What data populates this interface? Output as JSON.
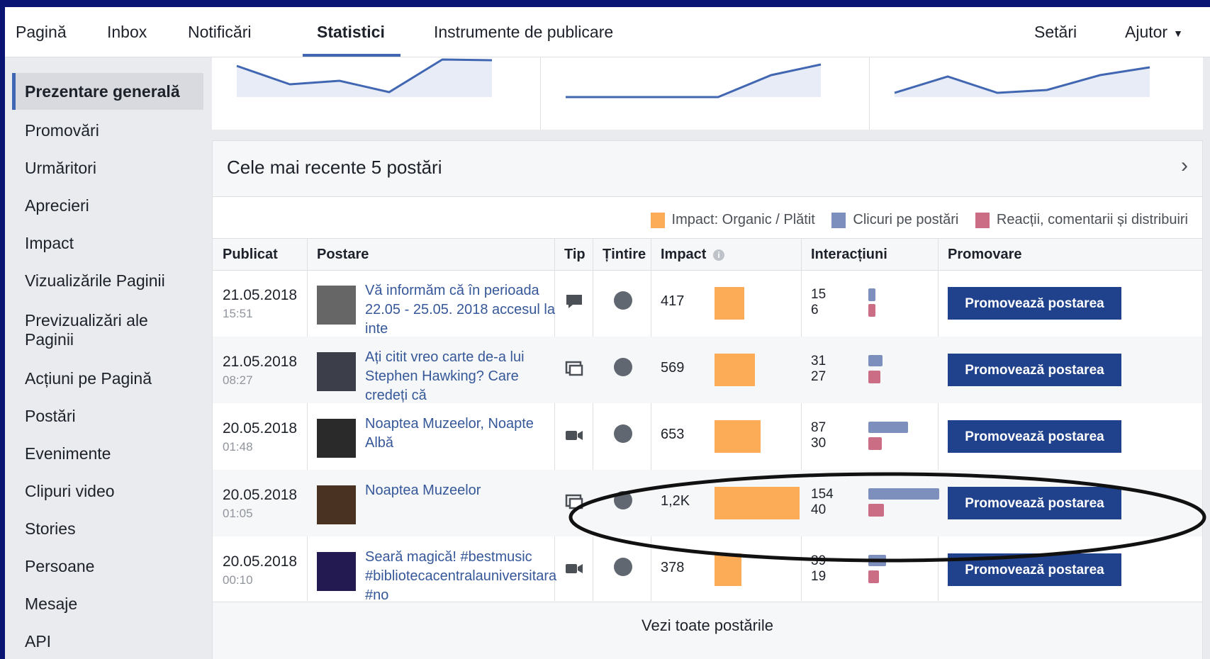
{
  "nav": {
    "tabs": [
      "Pagină",
      "Inbox",
      "Notificări",
      "Statistici",
      "Instrumente de publicare"
    ],
    "right": [
      "Setări",
      "Ajutor"
    ],
    "active_tab": "Statistici"
  },
  "sidebar": {
    "items": [
      "Prezentare generală",
      "Promovări",
      "Urmăritori",
      "Aprecieri",
      "Impact",
      "Vizualizările Paginii",
      "Previzualizări ale Paginii",
      "Acțiuni pe Pagină",
      "Postări",
      "Evenimente",
      "Clipuri video",
      "Stories",
      "Persoane",
      "Mesaje",
      "API"
    ],
    "active": "Prezentare generală"
  },
  "panel": {
    "title": "Cele mai recente 5 postări",
    "legend": [
      {
        "label": "Impact: Organic / Plătit",
        "color": "#fcab57"
      },
      {
        "label": "Clicuri pe postări",
        "color": "#7d8fbd"
      },
      {
        "label": "Reacții, comentarii și distribuiri",
        "color": "#cc6d86"
      }
    ],
    "columns": [
      "Publicat",
      "Postare",
      "Tip",
      "Țintire",
      "Impact",
      "Interacțiuni",
      "Promovare"
    ],
    "see_all": "Vezi toate postările",
    "promote_label": "Promovează postarea"
  },
  "posts": [
    {
      "date": "21.05.2018",
      "time": "15:51",
      "text": "Vă informăm că în perioada 22.05 - 25.05. 2018 accesul la inte",
      "type": "status",
      "impact": "417",
      "impact_value": 417,
      "clicks": "15",
      "reactions": "6"
    },
    {
      "date": "21.05.2018",
      "time": "08:27",
      "text": "Ați citit vreo carte de-a lui Stephen Hawking? Care credeți că",
      "type": "album",
      "impact": "569",
      "impact_value": 569,
      "clicks": "31",
      "reactions": "27"
    },
    {
      "date": "20.05.2018",
      "time": "01:48",
      "text": "Noaptea Muzeelor, Noapte Albă",
      "type": "video",
      "impact": "653",
      "impact_value": 653,
      "clicks": "87",
      "reactions": "30"
    },
    {
      "date": "20.05.2018",
      "time": "01:05",
      "text": "Noaptea Muzeelor",
      "type": "album",
      "impact": "1,2K",
      "impact_value": 1200,
      "clicks": "154",
      "reactions": "40"
    },
    {
      "date": "20.05.2018",
      "time": "00:10",
      "text": "Seară magică! #bestmusic #bibliotecacentralauniversitara #no",
      "type": "video",
      "impact": "378",
      "impact_value": 378,
      "clicks": "39",
      "reactions": "19"
    }
  ]
}
